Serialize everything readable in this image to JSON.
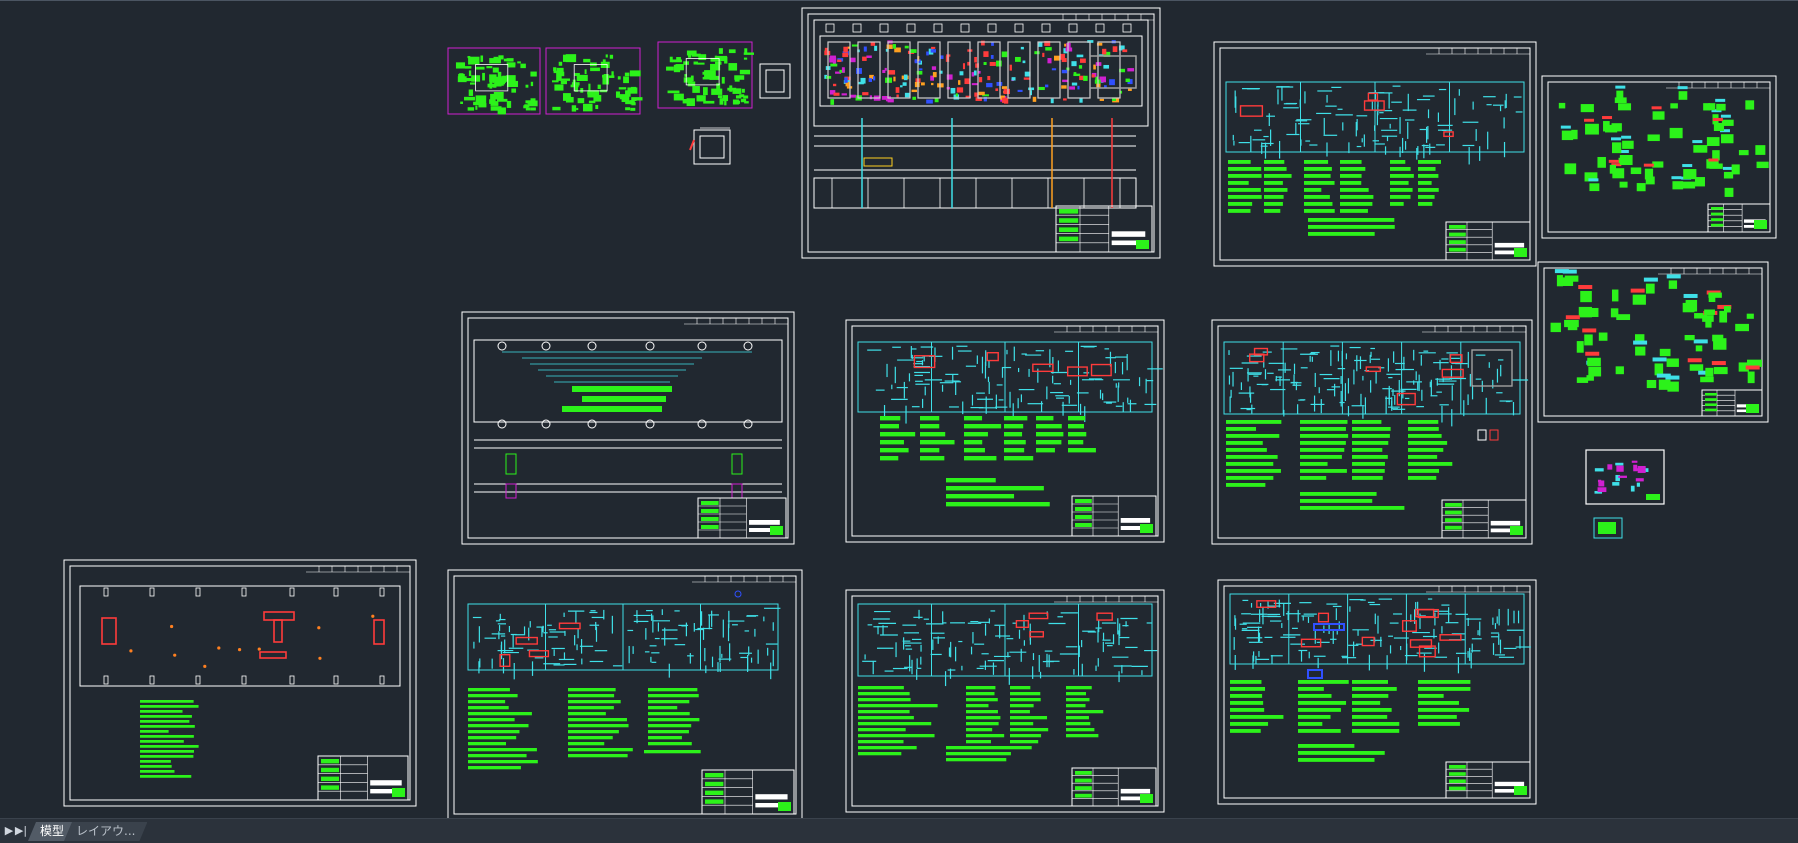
{
  "tabs": {
    "model_label": "模型",
    "layout_label": "レイアウ..."
  },
  "nav": {
    "first_icon": "triangle-right-icon",
    "last_icon": "skip-end-icon"
  },
  "colors": {
    "background": "#212830",
    "frame": "#ffffff",
    "dimension": "#3fe0e8",
    "annotation": "#2cf21a",
    "highlight": "#ff3030",
    "accent": "#d020d0"
  }
}
